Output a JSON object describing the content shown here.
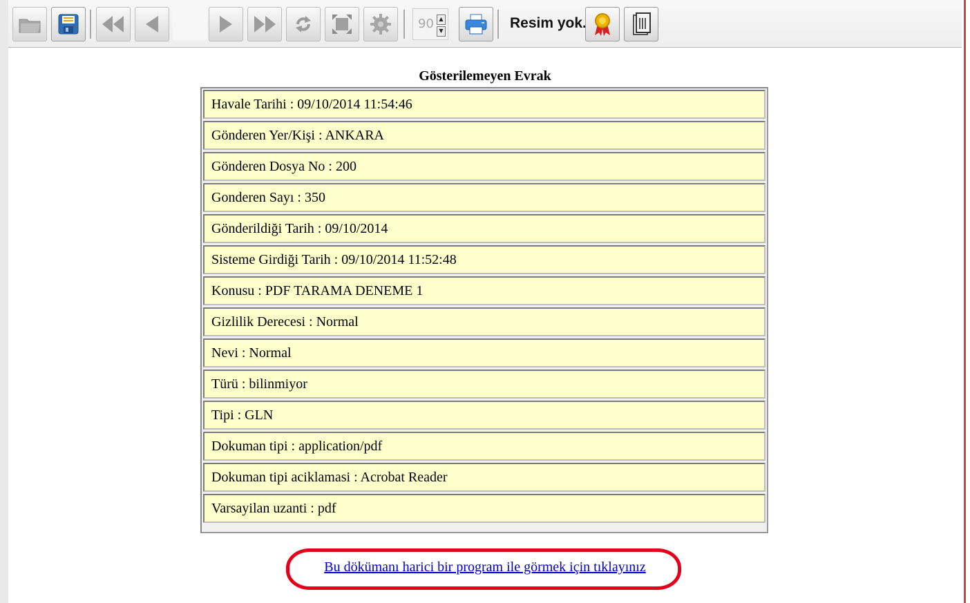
{
  "toolbar": {
    "buttons": [
      {
        "name": "open-icon",
        "enabled": false
      },
      {
        "name": "save-icon",
        "enabled": true
      },
      {
        "name": "first-page-icon",
        "enabled": false
      },
      {
        "name": "prev-page-icon",
        "enabled": false
      },
      {
        "name": "next-page-icon",
        "enabled": false
      },
      {
        "name": "last-page-icon",
        "enabled": false
      },
      {
        "name": "rotate-icon",
        "enabled": false
      },
      {
        "name": "fit-page-icon",
        "enabled": false
      },
      {
        "name": "settings-icon",
        "enabled": false
      },
      {
        "name": "print-icon",
        "enabled": true
      },
      {
        "name": "certificate-icon",
        "enabled": true
      },
      {
        "name": "document-icon",
        "enabled": true
      }
    ],
    "zoom_value": "90",
    "image_status": "Resim yok."
  },
  "document": {
    "title": "Gösterilemeyen Evrak",
    "rows": [
      "Havale Tarihi : 09/10/2014 11:54:46",
      "Gönderen Yer/Kişi : ANKARA",
      "Gönderen Dosya No : 200",
      "Gonderen Sayı : 350",
      "Gönderildiği Tarih : 09/10/2014",
      "Sisteme Girdiği Tarih : 09/10/2014 11:52:48",
      "Konusu : PDF TARAMA DENEME 1",
      "Gizlilik Derecesi : Normal",
      "Nevi : Normal",
      "Türü : bilinmiyor",
      "Tipi : GLN",
      "Dokuman tipi : application/pdf",
      "Dokuman tipi aciklamasi : Acrobat Reader",
      "Varsayilan uzanti : pdf"
    ],
    "external_link": "Bu dökümanı harici bir program ile görmek için tıklayınız"
  },
  "colors": {
    "row_background": "#ffffcc",
    "link": "#0000cc",
    "highlight": "#e3001b"
  }
}
